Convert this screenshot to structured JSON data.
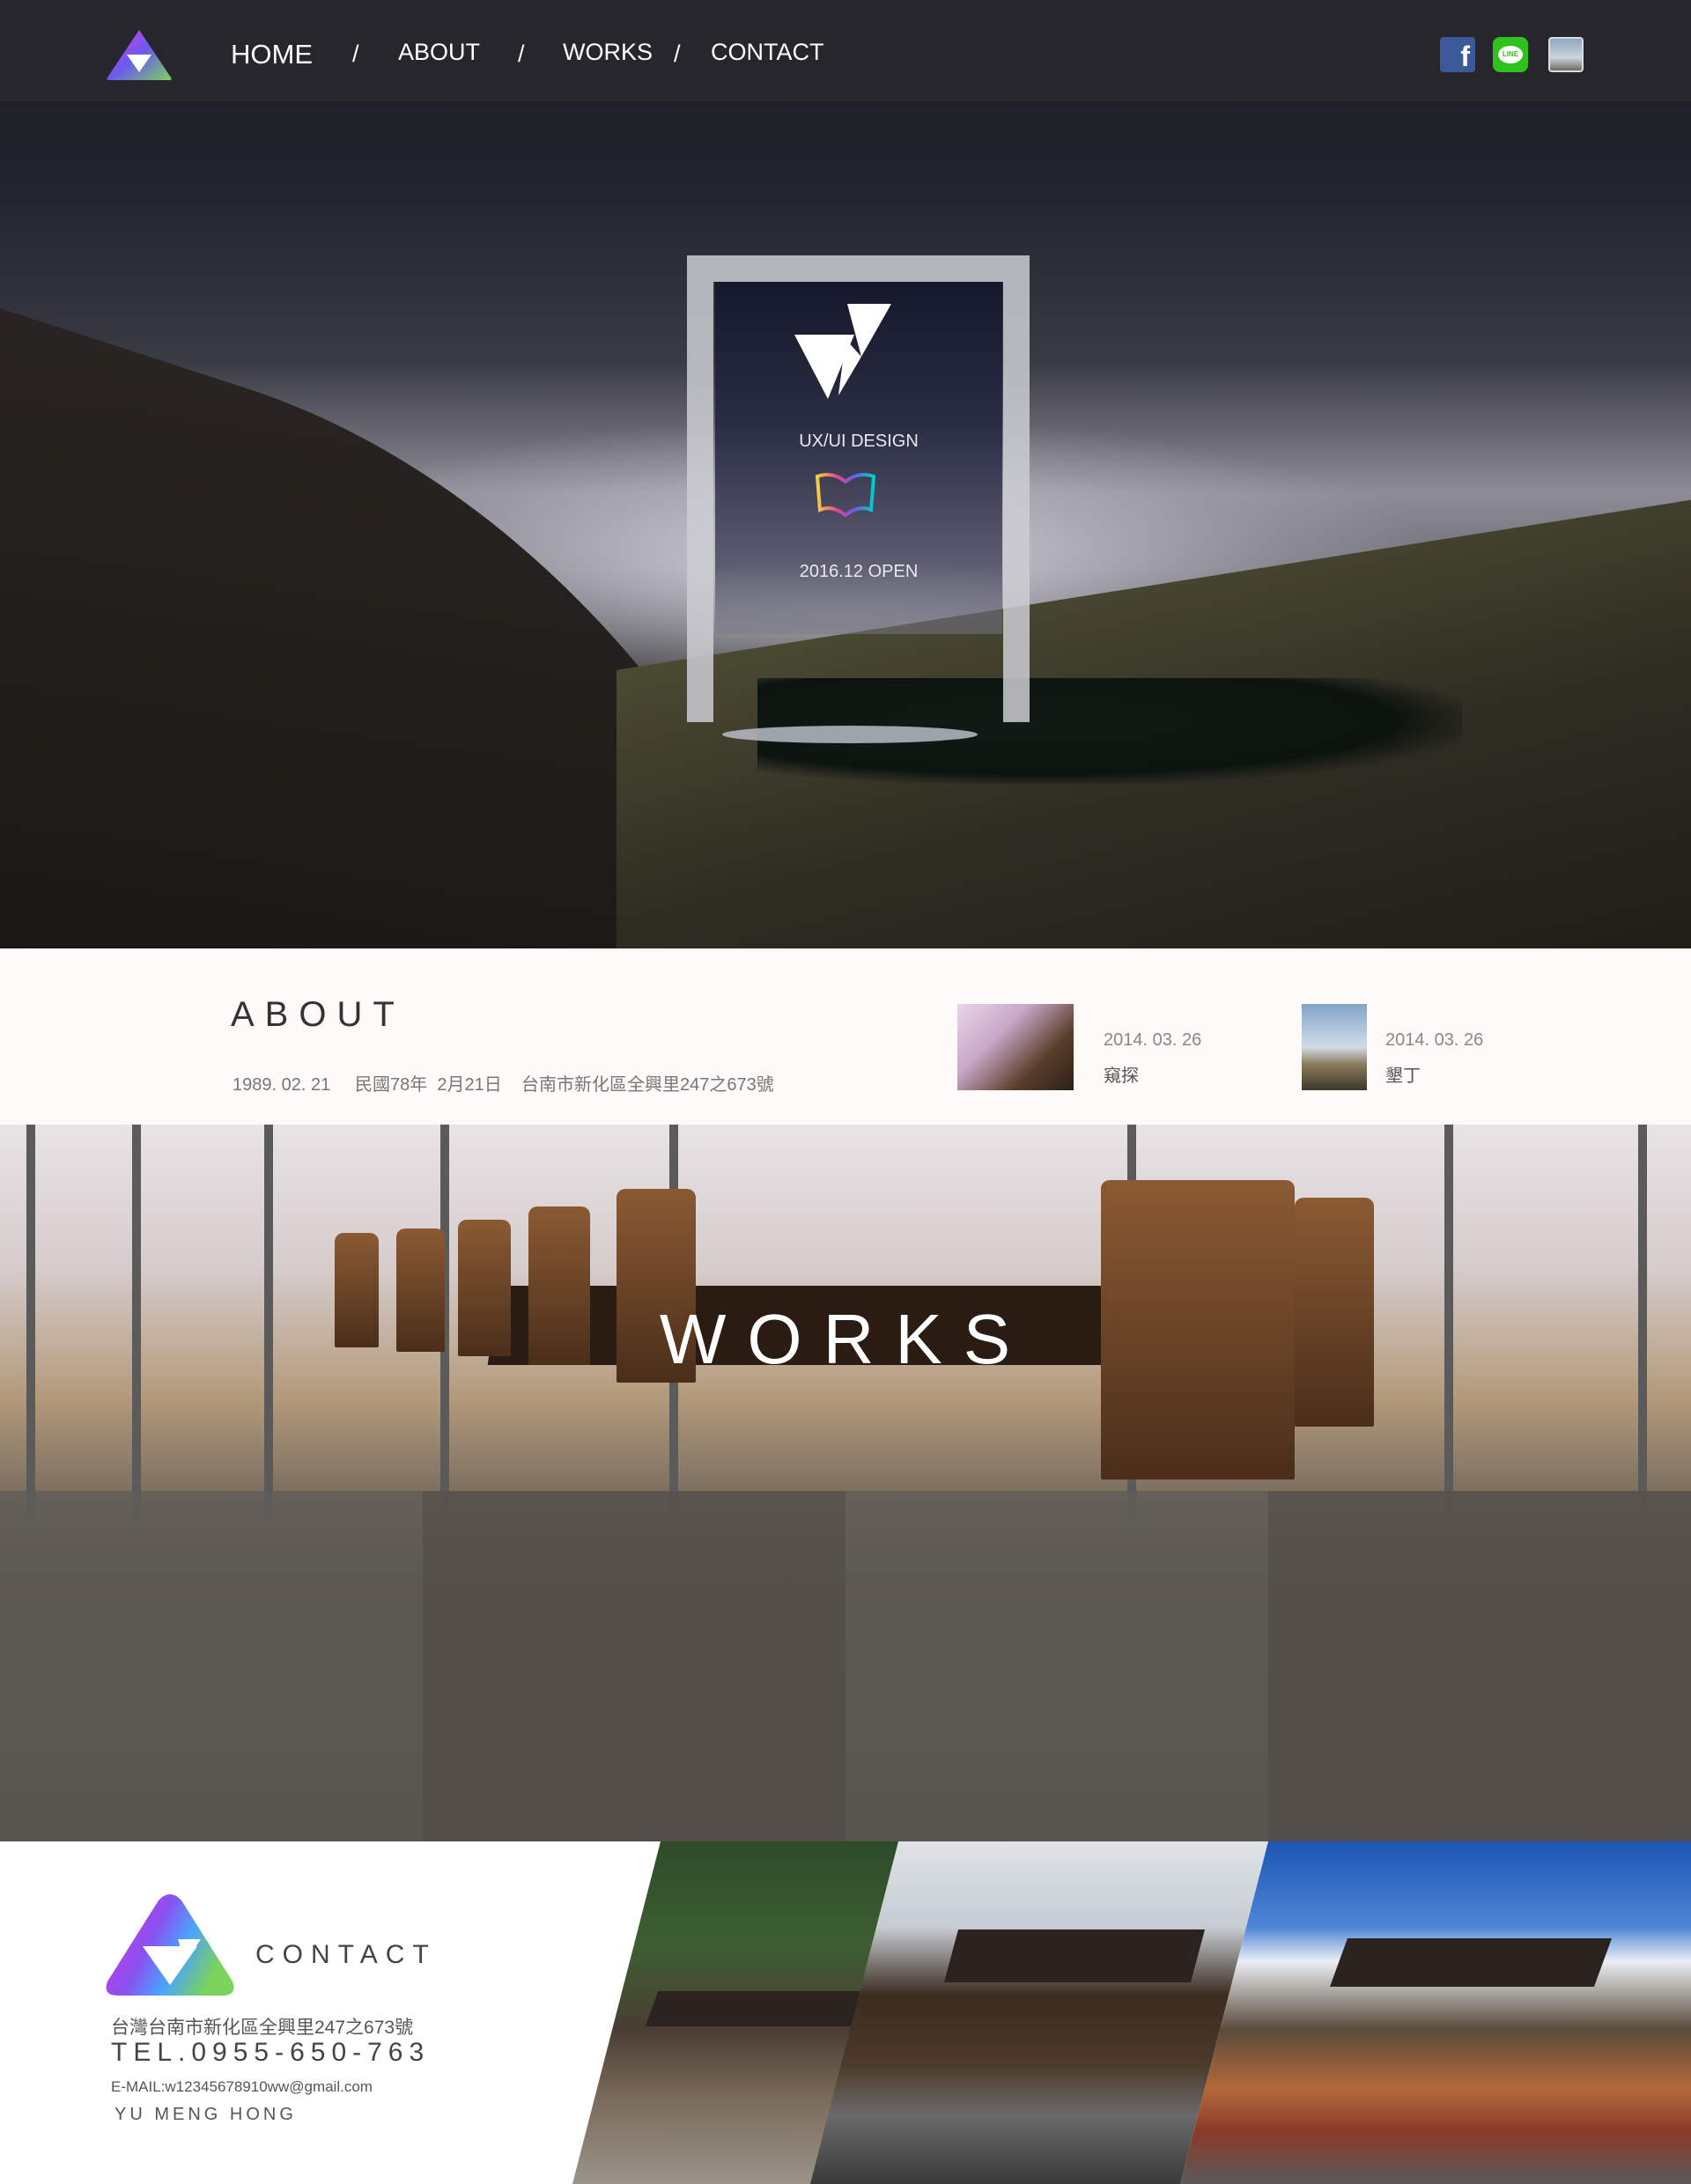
{
  "nav": {
    "items": [
      "HOME",
      "ABOUT",
      "WORKS",
      "CONTACT"
    ],
    "separator": "/",
    "social": [
      "facebook-icon",
      "line-icon",
      "avatar-icon"
    ],
    "line_label": "LINE"
  },
  "hero": {
    "tagline": "UX/UI  DESIGN",
    "open_text": "2016.12 OPEN"
  },
  "about": {
    "title": "ABOUT",
    "info": "1989. 02. 21     民國78年  2月21日    台南市新化區全興里247之673號",
    "news": [
      {
        "date": "2014. 03. 26",
        "title": "窺探"
      },
      {
        "date": "2014. 03. 26",
        "title": "墾丁"
      }
    ]
  },
  "works": {
    "title": "WORKS"
  },
  "contact": {
    "title": "CONTACT",
    "address": "台灣台南市新化區全興里247之673號",
    "tel": "TEL.0955-650-763",
    "email": "E-MAIL:w12345678910ww@gmail.com",
    "name": "YU   MENG   HONG"
  },
  "colors": {
    "logo_gradient": [
      "#e23be0",
      "#8a4ff0",
      "#4aa3ff",
      "#7ad35a"
    ],
    "nav_bg": "#28282e",
    "about_bg": "#fdfaf7"
  }
}
